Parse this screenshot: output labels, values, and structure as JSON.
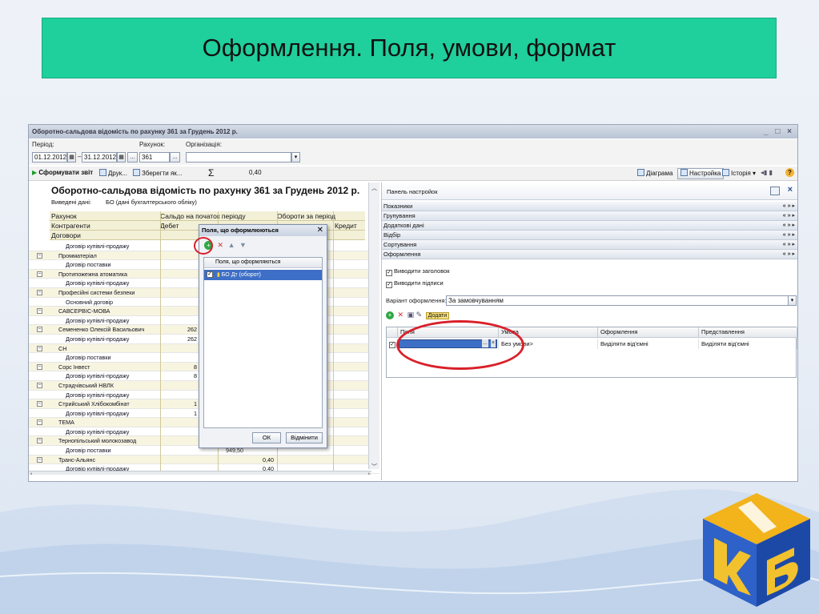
{
  "slide": {
    "title": "Оформлення. Поля, умови, формат"
  },
  "window": {
    "title": "Оборотно-сальдова відомість по рахунку 361 за Грудень 2012 р.",
    "controls": "_ □ ×"
  },
  "params": {
    "period_label": "Період:",
    "period_from": "01.12.2012",
    "period_to": "31.12.2012",
    "dash": "–",
    "ellipsis": "...",
    "account_label": "Рахунок:",
    "account_value": "361",
    "org_label": "Організація:",
    "org_value": ""
  },
  "toolbar": {
    "generate": "Сформувати звіт",
    "print": "Друк...",
    "save_as": "Зберегти як...",
    "sigma": "Σ",
    "sum": "0,40",
    "chart": "Діаграма",
    "settings": "Настройка",
    "history": "Історія ▾"
  },
  "report": {
    "title": "Оборотно-сальдова відомість по рахунку 361 за Грудень 2012 р.",
    "shown_label": "Виведені дані:",
    "shown_value": "БО (дані бухгалтерського обліку)",
    "headers": {
      "account": "Рахунок",
      "counterparty": "Контрагенти",
      "contracts": "Договори",
      "opening": "Сальдо на початок періоду",
      "turnover": "Обороти за період",
      "debit": "Дебет",
      "credit": "Кредит"
    },
    "rows": [
      {
        "name": "Договір купівлі-продажу",
        "level": 2,
        "v1": "",
        "v2": ""
      },
      {
        "name": "Промматеріал",
        "level": 1,
        "v1": "",
        "v2": ""
      },
      {
        "name": "Договір поставки",
        "level": 2,
        "v1": "",
        "v2": ""
      },
      {
        "name": "Протипожежна атоматика",
        "level": 1,
        "v1": "",
        "v2": ""
      },
      {
        "name": "Договір купівлі-продажу",
        "level": 2,
        "v1": "",
        "v2": ""
      },
      {
        "name": "Професійні системи безпеки",
        "level": 1,
        "v1": "",
        "v2": ""
      },
      {
        "name": "Основний договір",
        "level": 2,
        "v1": "",
        "v2": ""
      },
      {
        "name": "САВСЕРВІС-МОВА",
        "level": 1,
        "v1": "",
        "v2": ""
      },
      {
        "name": "Договір купівлі-продажу",
        "level": 2,
        "v1": "",
        "v2": ""
      },
      {
        "name": "Семененко Олексій Васильович",
        "level": 1,
        "v1": "262",
        "v2": ""
      },
      {
        "name": "Договір купівлі-продажу",
        "level": 2,
        "v1": "262",
        "v2": ""
      },
      {
        "name": "СН",
        "level": 1,
        "v1": "",
        "v2": ""
      },
      {
        "name": "Договір поставки",
        "level": 2,
        "v1": "",
        "v2": ""
      },
      {
        "name": "Сорс Інвест",
        "level": 1,
        "v1": "8",
        "v2": ""
      },
      {
        "name": "Договір купівлі-продажу",
        "level": 2,
        "v1": "8",
        "v2": ""
      },
      {
        "name": "Страдчівський НВЛК",
        "level": 1,
        "v1": "",
        "v2": ""
      },
      {
        "name": "Договір купівлі-продажу",
        "level": 2,
        "v1": "",
        "v2": ""
      },
      {
        "name": "Стрийський Хлібокомбінат",
        "level": 1,
        "v1": "1",
        "v2": ""
      },
      {
        "name": "Договір купівлі-продажу",
        "level": 2,
        "v1": "1",
        "v2": ""
      },
      {
        "name": "ТЕМА",
        "level": 1,
        "v1": "",
        "v2": ""
      },
      {
        "name": "Договір купівлі-продажу",
        "level": 2,
        "v1": "",
        "v2": ""
      },
      {
        "name": "Тернопільський молокозавод",
        "level": 1,
        "v1": "",
        "v2": ""
      },
      {
        "name": "Договір поставки",
        "level": 2,
        "v1": "",
        "v2": ""
      },
      {
        "name": "Транс-Альянс",
        "level": 1,
        "v1": "",
        "v2": "0,40"
      },
      {
        "name": "Договір купівлі-продажу",
        "level": 2,
        "v1": "",
        "v2": "0,40"
      }
    ],
    "partial_value": "949,50"
  },
  "panel": {
    "title": "Панель настройок",
    "sections": [
      "Показники",
      "Групування",
      "Додаткові дані",
      "Відбір",
      "Сортування",
      "Оформлення"
    ],
    "arrows": "« » ▸",
    "show_titles": "Виводити заголовок",
    "show_signatures": "Виводити підписи",
    "variant_label": "Варіант оформлення:",
    "variant_value": "За замовчуванням",
    "grid_headers": [
      "Поля",
      "Умова",
      "Оформлення",
      "Представлення"
    ],
    "grid_row": {
      "condition": "Без умови>",
      "format": "Виділяти від'ємні",
      "present": "Виділяти від'ємні"
    },
    "add_label": "Додати"
  },
  "dialog": {
    "title": "Поля, що оформлюються",
    "list_header": "Поля, що оформляються",
    "item": "БО Дт (оборот)",
    "ok": "ОК",
    "cancel": "Відмінити"
  },
  "colors": {
    "title_bar": "#1fcf9c",
    "highlight_ring": "#d9202a",
    "selection": "#3d6fc6"
  }
}
